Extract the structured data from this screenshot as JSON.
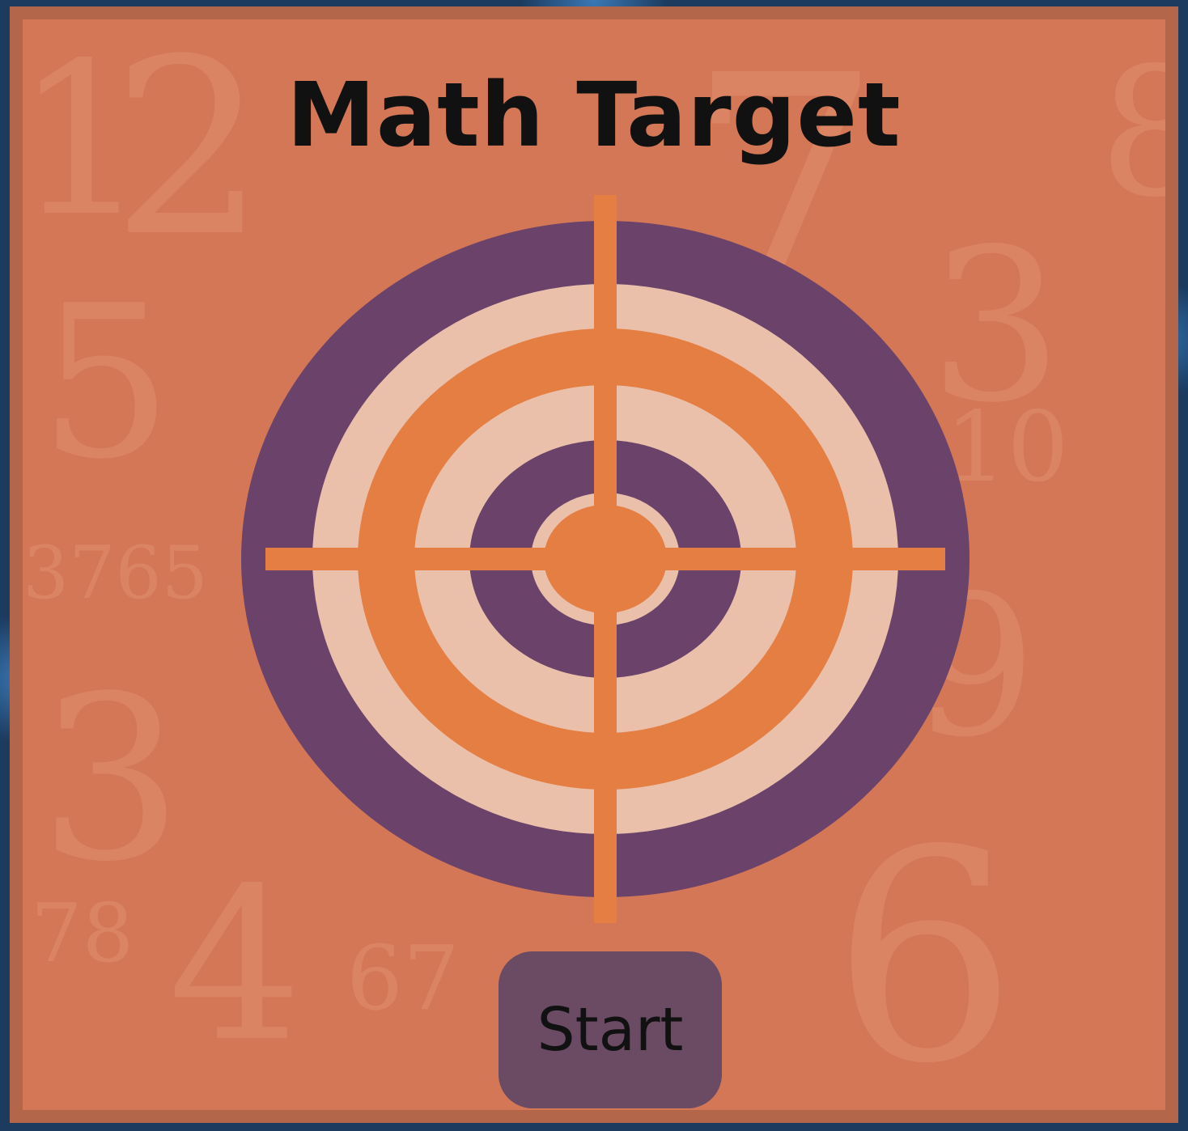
{
  "game": {
    "title": "Math Target",
    "start_label": "Start"
  },
  "colors": {
    "outer_background": "#1c3b5f",
    "panel_background": "#d37756",
    "panel_border": "#b4664a",
    "target_purple": "#6a426a",
    "target_light": "#ebc0ab",
    "target_orange": "#e47e42",
    "button_background": "#6b4a64"
  },
  "icons": {
    "target": "target-icon"
  }
}
